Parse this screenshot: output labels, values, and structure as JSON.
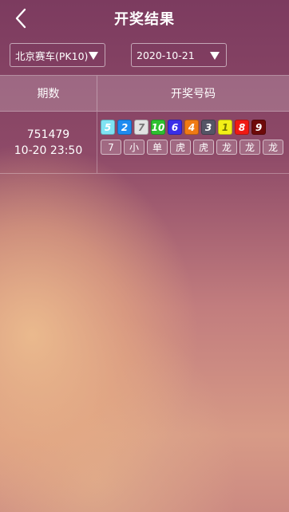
{
  "header": {
    "title": "开奖结果"
  },
  "filters": {
    "lottery": "北京赛车(PK10)",
    "date": "2020-10-21"
  },
  "table": {
    "col1": "期数",
    "col2": "开奖号码",
    "rows": [
      {
        "issue": "751479",
        "time": "10-20 23:50",
        "balls": [
          {
            "n": "5",
            "bg": "#7fe3f3",
            "fg": "#ffffff"
          },
          {
            "n": "2",
            "bg": "#1f8bf0",
            "fg": "#ffffff"
          },
          {
            "n": "7",
            "bg": "#e2e2e2",
            "fg": "#777777"
          },
          {
            "n": "10",
            "bg": "#2ec030",
            "fg": "#ffffff"
          },
          {
            "n": "6",
            "bg": "#3a2ee8",
            "fg": "#ffffff"
          },
          {
            "n": "4",
            "bg": "#f07a14",
            "fg": "#ffffff"
          },
          {
            "n": "3",
            "bg": "#555566",
            "fg": "#ffffff"
          },
          {
            "n": "1",
            "bg": "#f2ef17",
            "fg": "#777700"
          },
          {
            "n": "8",
            "bg": "#f01a14",
            "fg": "#ffffff"
          },
          {
            "n": "9",
            "bg": "#6e0a0a",
            "fg": "#ffffff"
          }
        ],
        "attrs": [
          "7",
          "小",
          "单",
          "虎",
          "虎",
          "龙",
          "龙",
          "龙"
        ]
      }
    ]
  }
}
